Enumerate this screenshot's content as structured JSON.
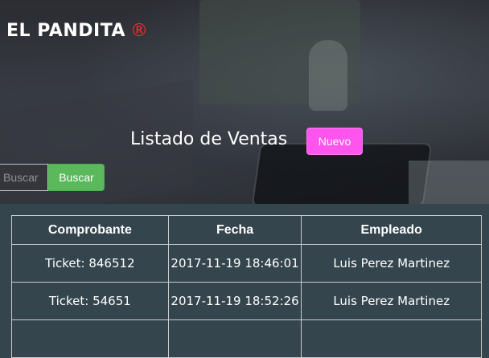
{
  "navbar": {
    "brand": "EL PANDITA",
    "brand_mark": "®"
  },
  "header": {
    "title": "Listado de Ventas",
    "new_button": "Nuevo"
  },
  "search": {
    "placeholder": "Buscar",
    "button": "Buscar"
  },
  "table": {
    "columns": [
      "Comprobante",
      "Fecha",
      "Empleado"
    ],
    "rows": [
      [
        "Ticket: 846512",
        "2017-11-19 18:46:01",
        "Luis Perez Martinez"
      ],
      [
        "Ticket: 54651",
        "2017-11-19 18:52:26",
        "Luis Perez Martinez"
      ]
    ]
  },
  "colors": {
    "accent": "#ff55ee",
    "success": "#5cb85c",
    "brand_mark": "#ff2b2b",
    "table_bg": "#34454d"
  }
}
